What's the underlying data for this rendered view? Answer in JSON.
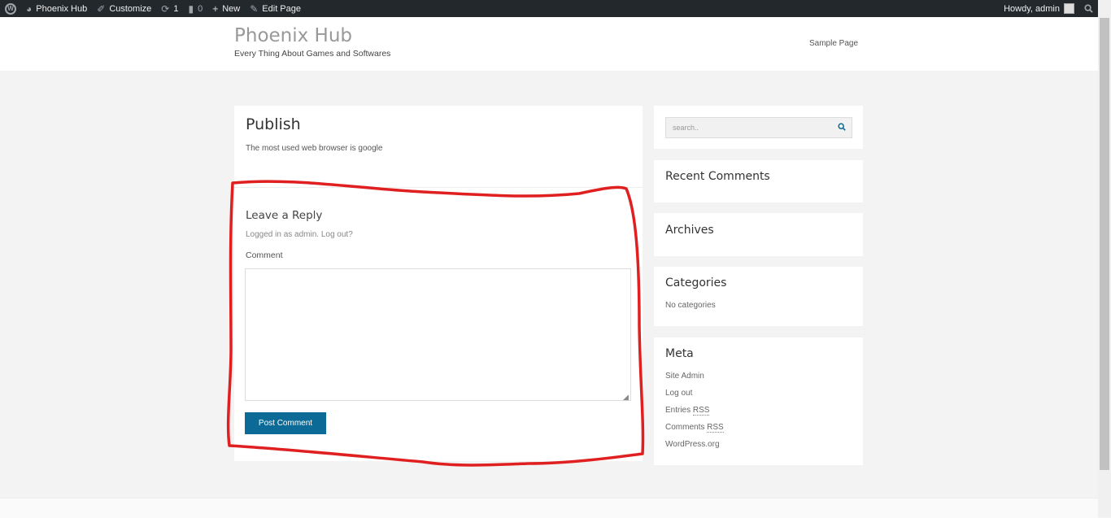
{
  "adminbar": {
    "site_name": "Phoenix Hub",
    "customize": "Customize",
    "updates_count": "1",
    "comments_count": "0",
    "new_label": "New",
    "edit_page": "Edit Page",
    "howdy": "Howdy, admin"
  },
  "header": {
    "site_title": "Phoenix Hub",
    "tagline": "Every Thing About Games and Softwares",
    "nav_item": "Sample Page"
  },
  "post": {
    "title": "Publish",
    "body": "The most used web browser is google"
  },
  "reply": {
    "title": "Leave a Reply",
    "logged_in": "Logged in as admin. Log out?",
    "comment_label": "Comment",
    "comment_value": "",
    "submit_label": "Post Comment"
  },
  "sidebar": {
    "search_placeholder": "search..",
    "recent_comments": "Recent Comments",
    "archives": "Archives",
    "categories": "Categories",
    "no_categories": "No categories",
    "meta": "Meta",
    "meta_links": {
      "site_admin": "Site Admin",
      "log_out": "Log out",
      "entries_prefix": "Entries ",
      "comments_prefix": "Comments ",
      "rss": "RSS",
      "wordpress": "WordPress.org"
    }
  },
  "colors": {
    "adminbar_bg": "#23282d",
    "button_bg": "#0b6b96",
    "annotation_red": "#e02020"
  }
}
